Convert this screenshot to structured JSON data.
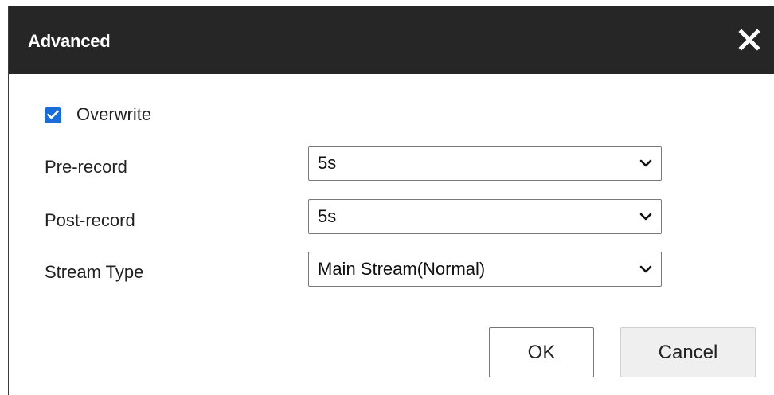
{
  "dialog": {
    "title": "Advanced",
    "close_icon": "close-icon"
  },
  "overwrite": {
    "label": "Overwrite",
    "checked": true
  },
  "fields": {
    "pre_record": {
      "label": "Pre-record",
      "value": "5s"
    },
    "post_record": {
      "label": "Post-record",
      "value": "5s"
    },
    "stream_type": {
      "label": "Stream Type",
      "value": "Main Stream(Normal)"
    }
  },
  "buttons": {
    "ok": "OK",
    "cancel": "Cancel"
  },
  "colors": {
    "titlebar": "#262626",
    "checkbox_accent": "#1a6dd8",
    "cancel_bg": "#efefef"
  }
}
